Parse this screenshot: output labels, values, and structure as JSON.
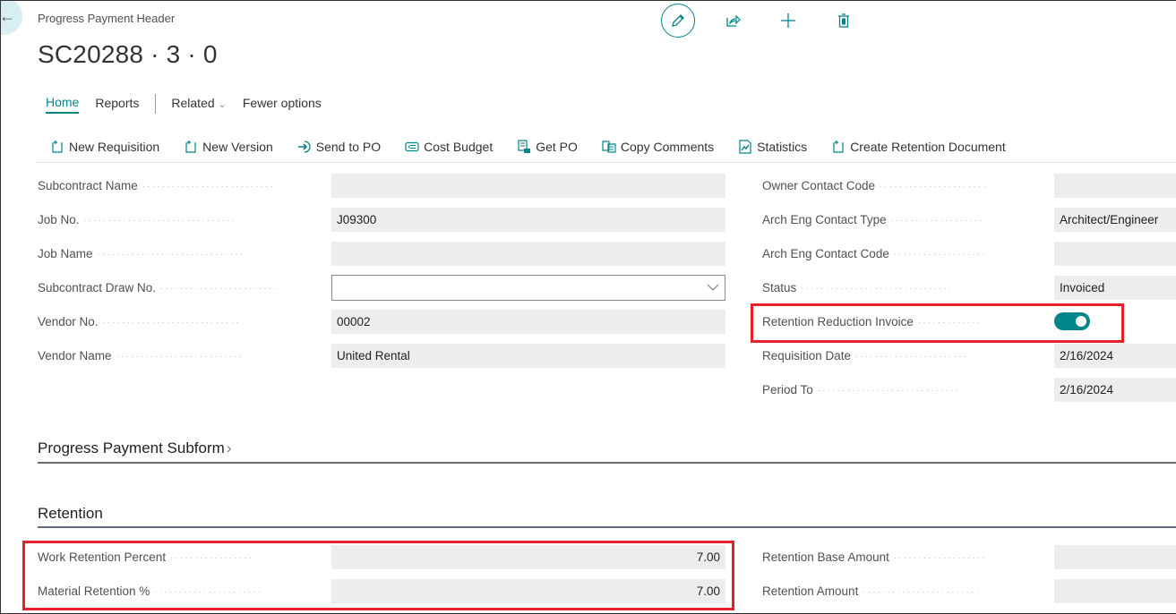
{
  "header": {
    "caption": "Progress Payment Header",
    "title": "SC20288 · 3 · 0"
  },
  "top_actions": [
    {
      "name": "edit",
      "icon": "pencil-icon"
    },
    {
      "name": "share",
      "icon": "share-icon"
    },
    {
      "name": "new",
      "icon": "plus-icon"
    },
    {
      "name": "delete",
      "icon": "trash-icon"
    }
  ],
  "tabs": [
    {
      "label": "Home",
      "active": true
    },
    {
      "label": "Reports"
    },
    {
      "label": "Related"
    },
    {
      "label": "Fewer options"
    }
  ],
  "actions": [
    {
      "label": "New Requisition",
      "icon": "new-document-icon"
    },
    {
      "label": "New Version",
      "icon": "new-document-icon"
    },
    {
      "label": "Send to PO",
      "icon": "send-arrow-icon"
    },
    {
      "label": "Cost Budget",
      "icon": "budget-icon"
    },
    {
      "label": "Get PO",
      "icon": "get-document-icon"
    },
    {
      "label": "Copy Comments",
      "icon": "copy-icon"
    },
    {
      "label": "Statistics",
      "icon": "statistics-icon"
    },
    {
      "label": "Create Retention Document",
      "icon": "new-document-icon"
    }
  ],
  "general": {
    "left": [
      {
        "label": "Subcontract Name",
        "value": ""
      },
      {
        "label": "Job No.",
        "value": "J09300"
      },
      {
        "label": "Job Name",
        "value": ""
      },
      {
        "label": "Subcontract Draw No.",
        "value": "",
        "type": "select"
      },
      {
        "label": "Vendor No.",
        "value": "00002"
      },
      {
        "label": "Vendor Name",
        "value": "United Rental"
      }
    ],
    "right": [
      {
        "label": "Owner Contact Code",
        "value": ""
      },
      {
        "label": "Arch Eng Contact Type",
        "value": "Architect/Engineer"
      },
      {
        "label": "Arch Eng Contact Code",
        "value": ""
      },
      {
        "label": "Status",
        "value": "Invoiced"
      },
      {
        "label": "Retention Reduction Invoice",
        "value": true,
        "type": "toggle"
      },
      {
        "label": "Requisition Date",
        "value": "2/16/2024"
      },
      {
        "label": "Period To",
        "value": "2/16/2024"
      }
    ]
  },
  "sections": {
    "subform": "Progress Payment Subform",
    "retention": "Retention"
  },
  "retention": {
    "left": [
      {
        "label": "Work Retention Percent",
        "value": "7.00"
      },
      {
        "label": "Material Retention %",
        "value": "7.00"
      }
    ],
    "right": [
      {
        "label": "Retention Base Amount",
        "value": ""
      },
      {
        "label": "Retention Amount",
        "value": ""
      }
    ]
  },
  "colors": {
    "accent": "#00858a",
    "highlight": "#e8202a",
    "field_bg": "#ebedef"
  }
}
